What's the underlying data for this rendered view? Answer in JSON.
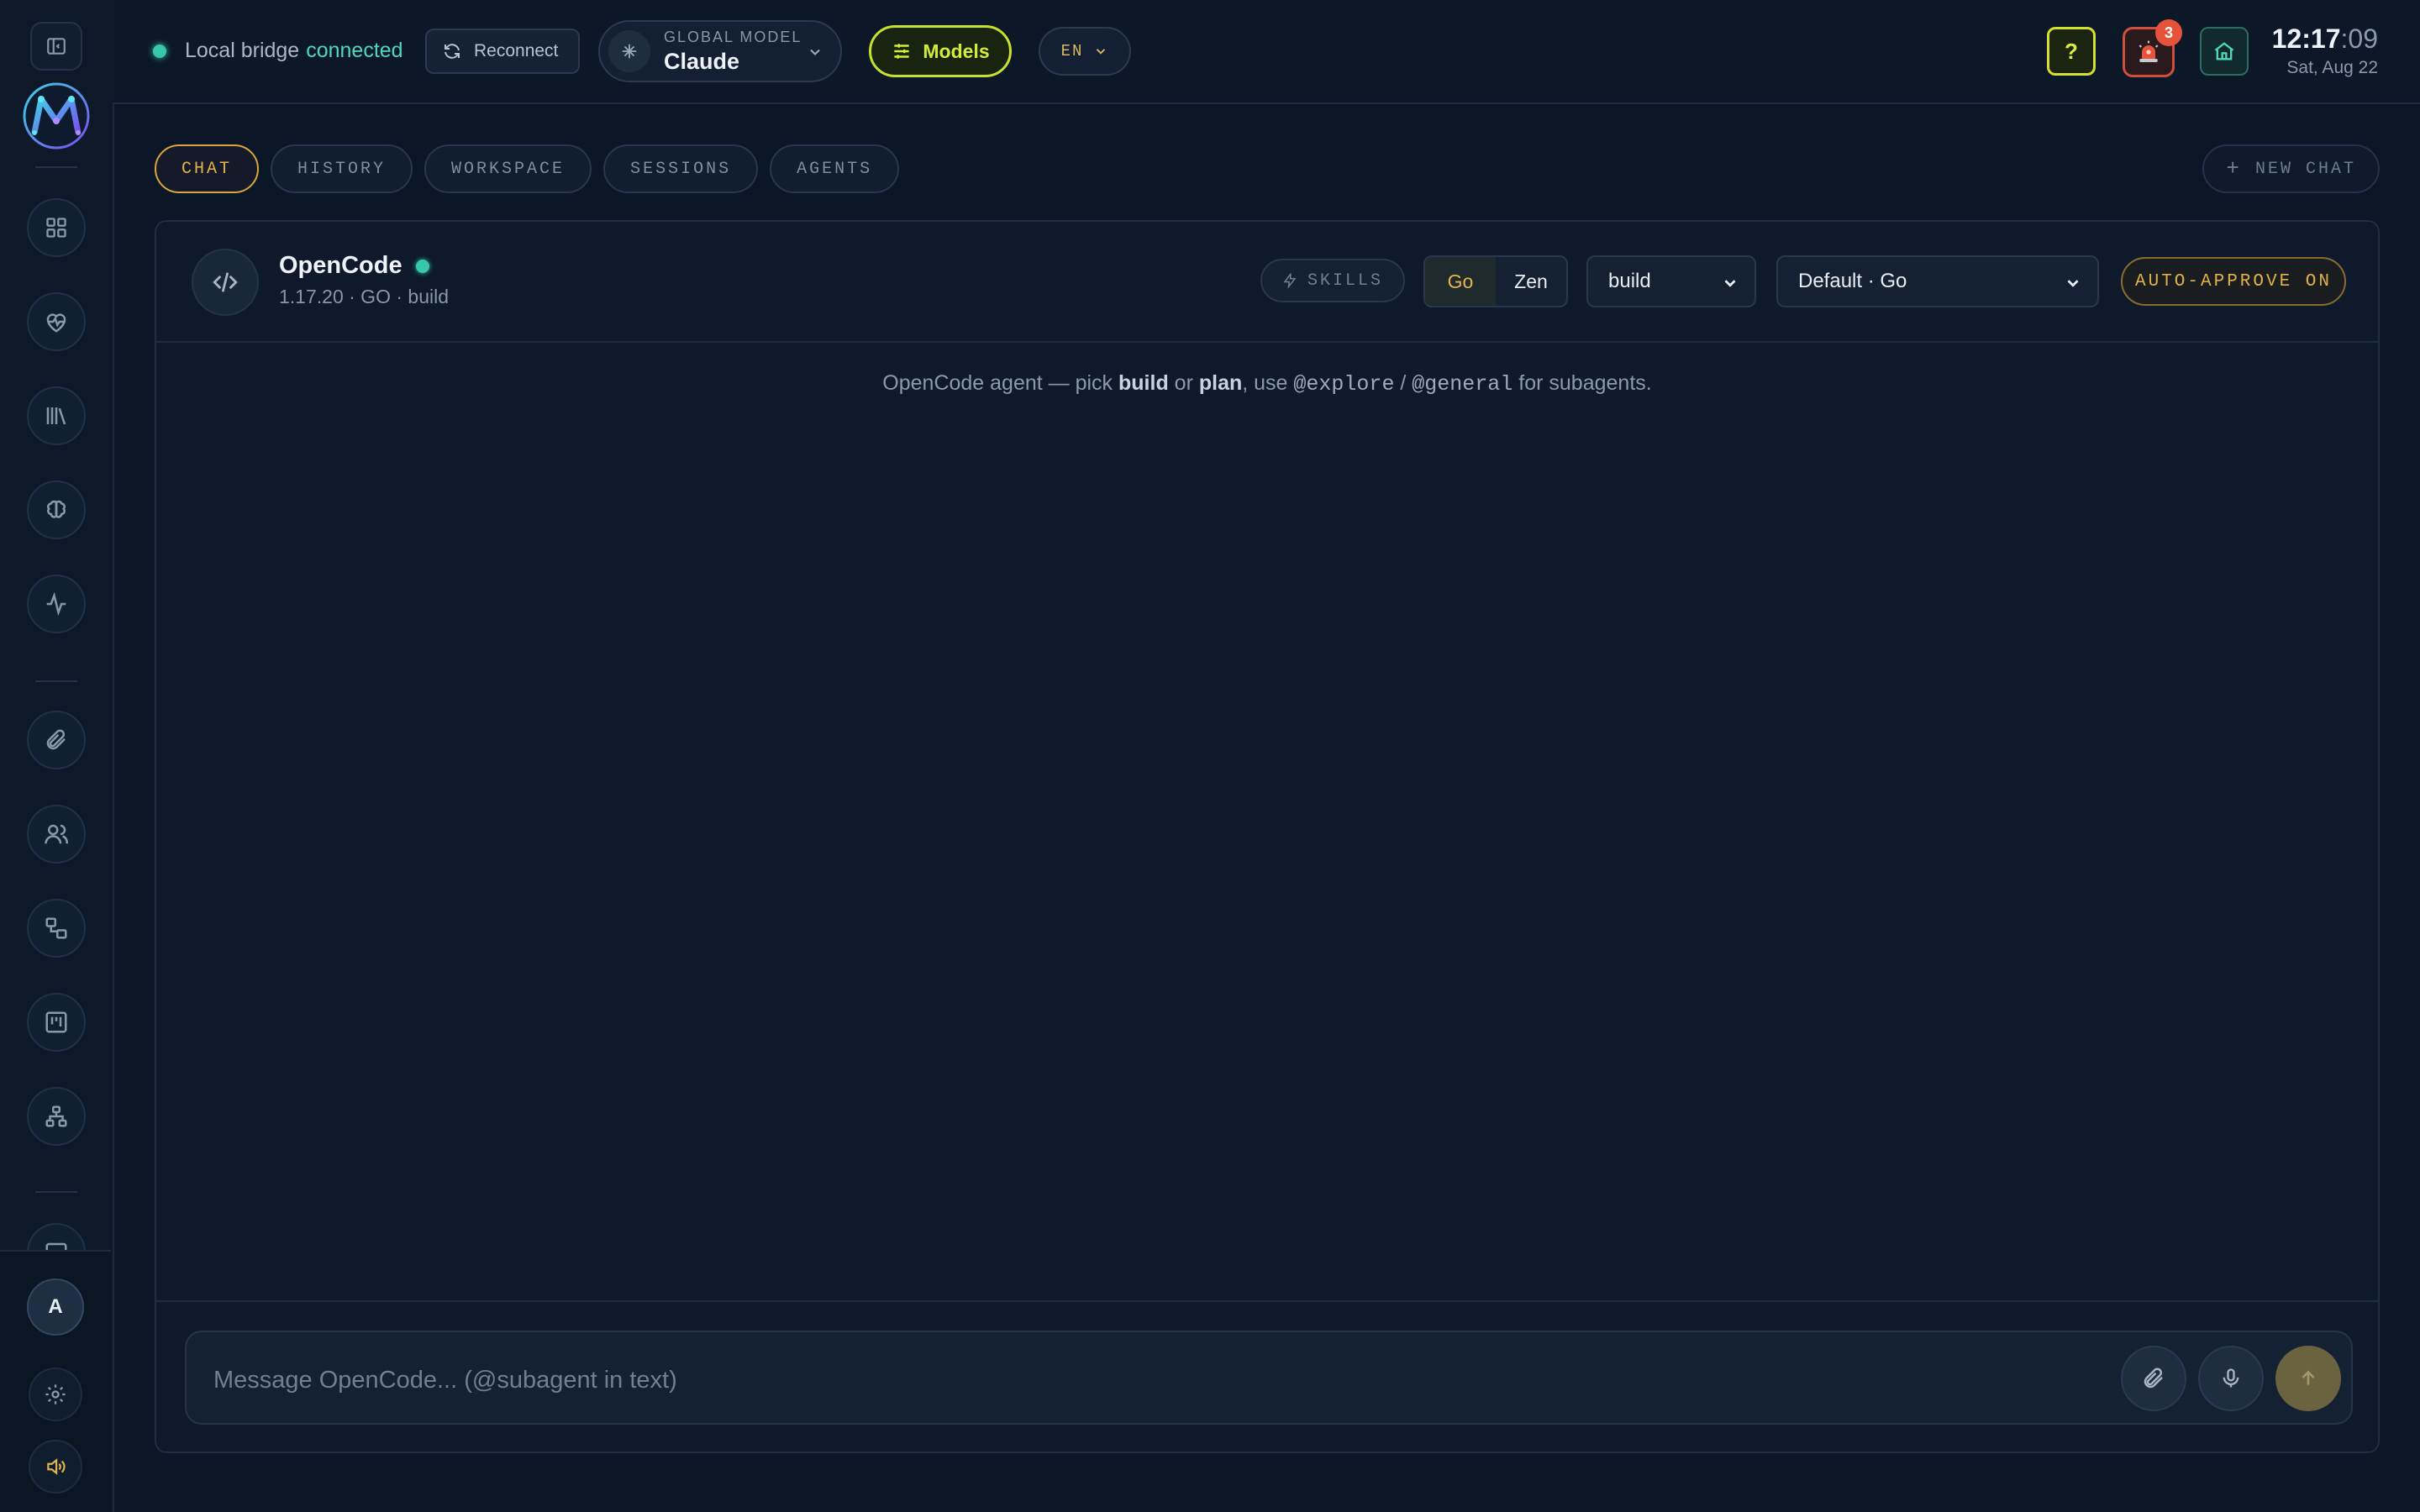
{
  "sidebar": {
    "nav_icons": [
      "dashboard-icon",
      "health-heart-icon",
      "library-icon",
      "brain-icon",
      "activity-icon",
      "paperclip-icon",
      "users-icon",
      "workflow-icon",
      "kanban-icon",
      "hierarchy-icon"
    ],
    "avatar_initial": "A"
  },
  "topbar": {
    "bridge_label": "Local bridge",
    "bridge_status": "connected",
    "reconnect_label": "Reconnect",
    "global_model_label": "GLOBAL MODEL",
    "global_model_value": "Claude",
    "models_label": "Models",
    "language": "EN",
    "help_label": "?",
    "alert_count": "3",
    "time_hm": "12:17",
    "time_sec": ":09",
    "date": "Sat, Aug 22"
  },
  "tabs": [
    {
      "label": "CHAT",
      "active": true
    },
    {
      "label": "HISTORY",
      "active": false
    },
    {
      "label": "WORKSPACE",
      "active": false
    },
    {
      "label": "SESSIONS",
      "active": false
    },
    {
      "label": "AGENTS",
      "active": false
    }
  ],
  "new_chat_label": "NEW CHAT",
  "agent": {
    "name": "OpenCode",
    "meta": "1.17.20 · GO · build",
    "skills_label": "SKILLS",
    "mode_go": "Go",
    "mode_zen": "Zen",
    "agent_select": "build",
    "model_select": "Default · Go",
    "auto_approve_label": "AUTO-APPROVE ON"
  },
  "hint": {
    "p1": "OpenCode agent — pick ",
    "b1": "build",
    "p2": " or ",
    "b2": "plan",
    "p3": ", use ",
    "c1": "@explore",
    "p4": " / ",
    "c2": "@general",
    "p5": " for subagents."
  },
  "composer": {
    "placeholder": "Message OpenCode... (@subagent in text)"
  },
  "colors": {
    "accent_gold": "#e3b44a",
    "accent_lime": "#d4ec38",
    "status_green": "#38c7a8",
    "alert_red": "#e5533b"
  }
}
